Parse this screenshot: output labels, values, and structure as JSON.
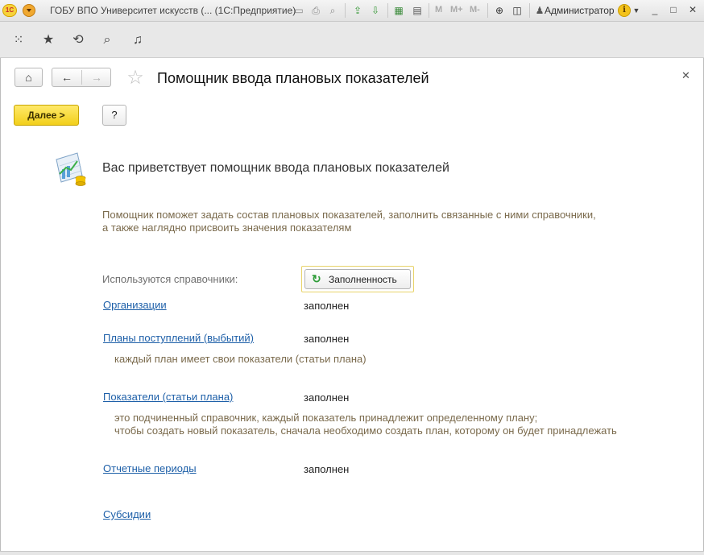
{
  "window": {
    "title": "ГОБУ ВПО Университет искусств (... (1С:Предприятие)",
    "user": "Администратор",
    "counters": [
      "M",
      "M+",
      "M-"
    ]
  },
  "form": {
    "title": "Помощник ввода плановых показателей",
    "next_label": "Далее >",
    "help_label": "?"
  },
  "content": {
    "welcome": "Вас приветствует помощник ввода плановых показателей",
    "description": "Помощник поможет задать состав плановых показателей, заполнить связанные с ними справочники, а также наглядно присвоить значения показателям",
    "used_label": "Используются справочники:",
    "fill_button": "Заполненность",
    "catalogs": [
      {
        "name": "Организации",
        "status": "заполнен",
        "note": ""
      },
      {
        "name": "Планы поступлений (выбытий)",
        "status": "заполнен",
        "note": "каждый план имеет свои показатели (статьи плана)"
      },
      {
        "name": "Показатели (статьи плана)",
        "status": "заполнен",
        "note": "это подчиненный справочник, каждый показатель принадлежит определенному плану;",
        "note2": "чтобы создать новый показатель, сначала необходимо создать план, которому он будет принадлежать"
      },
      {
        "name": "Отчетные периоды",
        "status": "заполнен",
        "note": ""
      },
      {
        "name": "Субсидии",
        "status": "",
        "note": ""
      }
    ]
  },
  "colors": {
    "accent_yellow": "#f2cf1a",
    "link": "#1d5fa8",
    "hint_text": "#7a6a4c"
  }
}
